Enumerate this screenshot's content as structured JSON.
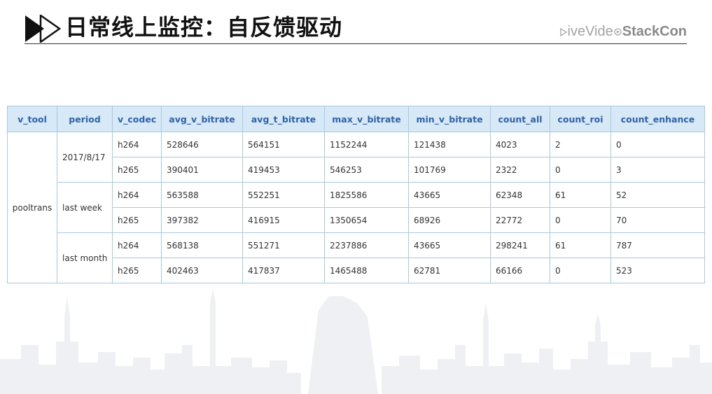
{
  "header": {
    "title": "日常线上监控：自反馈驱动",
    "logo": {
      "part1": "ive",
      "part2": "Vide",
      "part3": "StackCon"
    }
  },
  "table": {
    "columns": [
      "v_tool",
      "period",
      "v_codec",
      "avg_v_bitrate",
      "avg_t_bitrate",
      "max_v_bitrate",
      "min_v_bitrate",
      "count_all",
      "count_roi",
      "count_enhance"
    ],
    "v_tool": "pooltrans",
    "groups": [
      {
        "period": "2017/8/17",
        "rows": [
          [
            "h264",
            "528646",
            "564151",
            "1152244",
            "121438",
            "4023",
            "2",
            "0"
          ],
          [
            "h265",
            "390401",
            "419453",
            "546253",
            "101769",
            "2322",
            "0",
            "3"
          ]
        ]
      },
      {
        "period": "last week",
        "rows": [
          [
            "h264",
            "563588",
            "552251",
            "1825586",
            "43665",
            "62348",
            "61",
            "52"
          ],
          [
            "h265",
            "397382",
            "416915",
            "1350654",
            "68926",
            "22772",
            "0",
            "70"
          ]
        ]
      },
      {
        "period": "last month",
        "rows": [
          [
            "h264",
            "568138",
            "551271",
            "2237886",
            "43665",
            "298241",
            "61",
            "787"
          ],
          [
            "h265",
            "402463",
            "417837",
            "1465488",
            "62781",
            "66166",
            "0",
            "523"
          ]
        ]
      }
    ]
  },
  "colors": {
    "header_bg": "#d7e8f6",
    "header_text": "#2f62a8",
    "border": "#a9c8e1",
    "title": "#111111"
  }
}
